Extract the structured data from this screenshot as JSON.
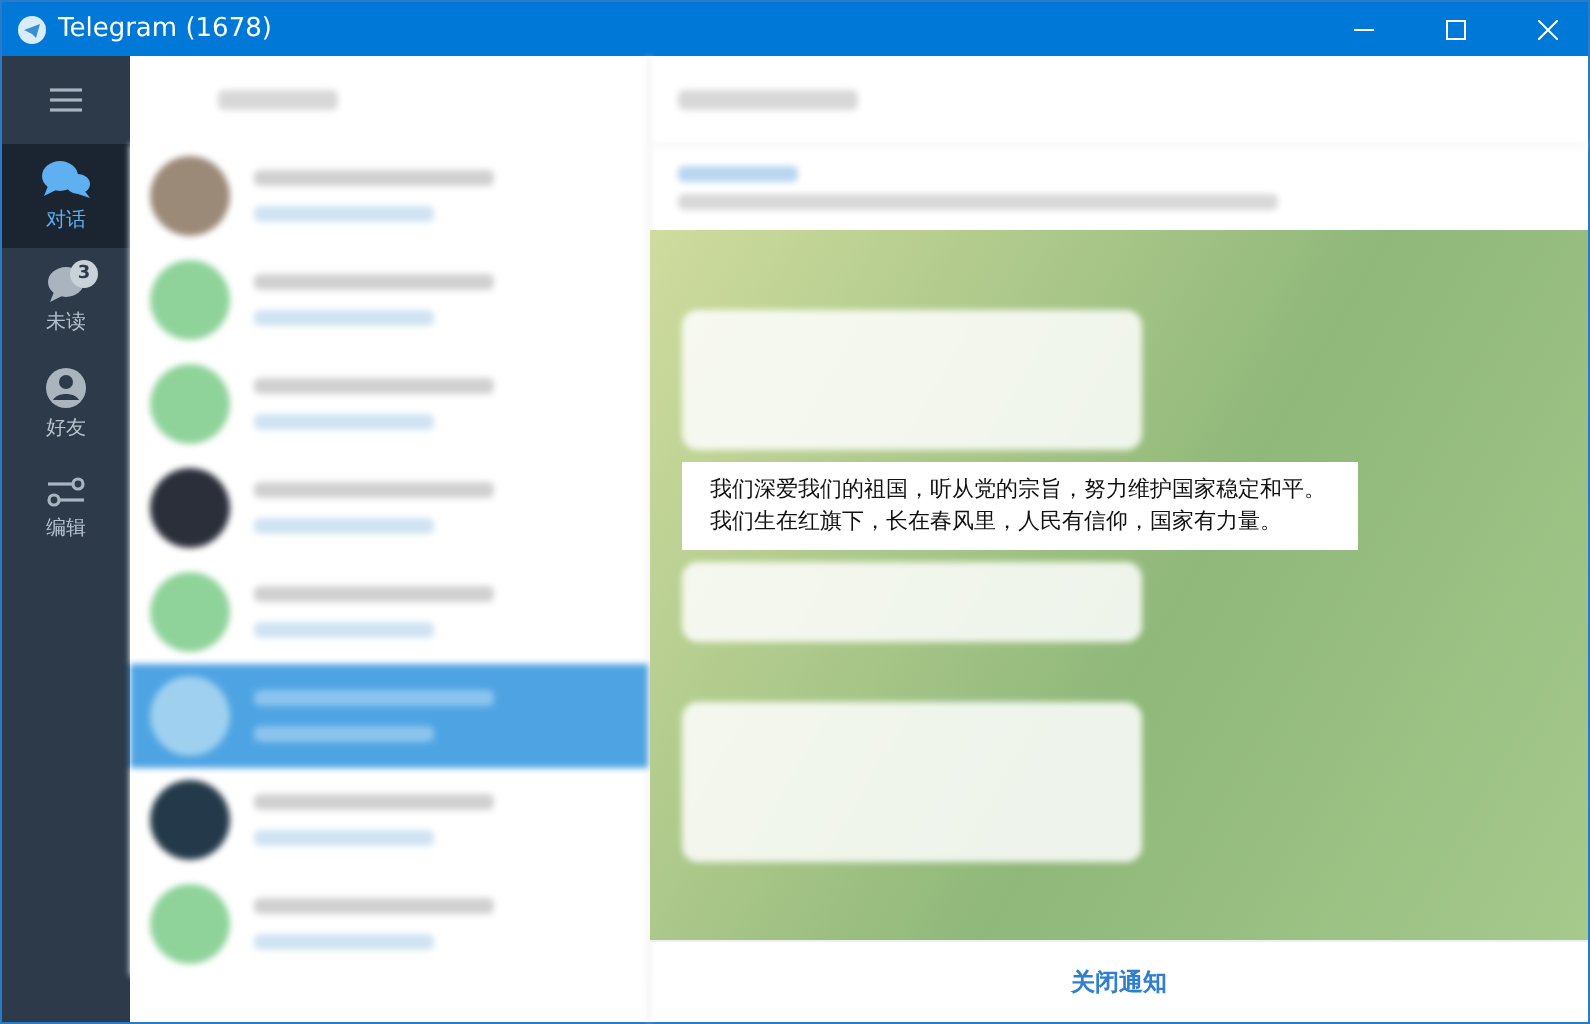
{
  "window": {
    "title": "Telegram (1678)"
  },
  "sidebar": {
    "items": [
      {
        "kind": "chats",
        "label": "对话",
        "selected": true
      },
      {
        "kind": "unread",
        "label": "未读",
        "badge": "3",
        "selected": false
      },
      {
        "kind": "contacts",
        "label": "好友",
        "selected": false
      },
      {
        "kind": "edit",
        "label": "编辑",
        "selected": false
      }
    ]
  },
  "chat_list": {
    "rows": [
      {
        "selected": false
      },
      {
        "selected": false
      },
      {
        "selected": false
      },
      {
        "selected": false
      },
      {
        "selected": false
      },
      {
        "selected": true
      },
      {
        "selected": false
      },
      {
        "selected": false
      }
    ]
  },
  "message": {
    "lines": [
      "我们深爱我们的祖国，听从党的宗旨，努力维护国家稳定和平。",
      "我们生在红旗下，长在春风里，人民有信仰，国家有力量。"
    ]
  },
  "footer": {
    "button": "关闭通知"
  }
}
